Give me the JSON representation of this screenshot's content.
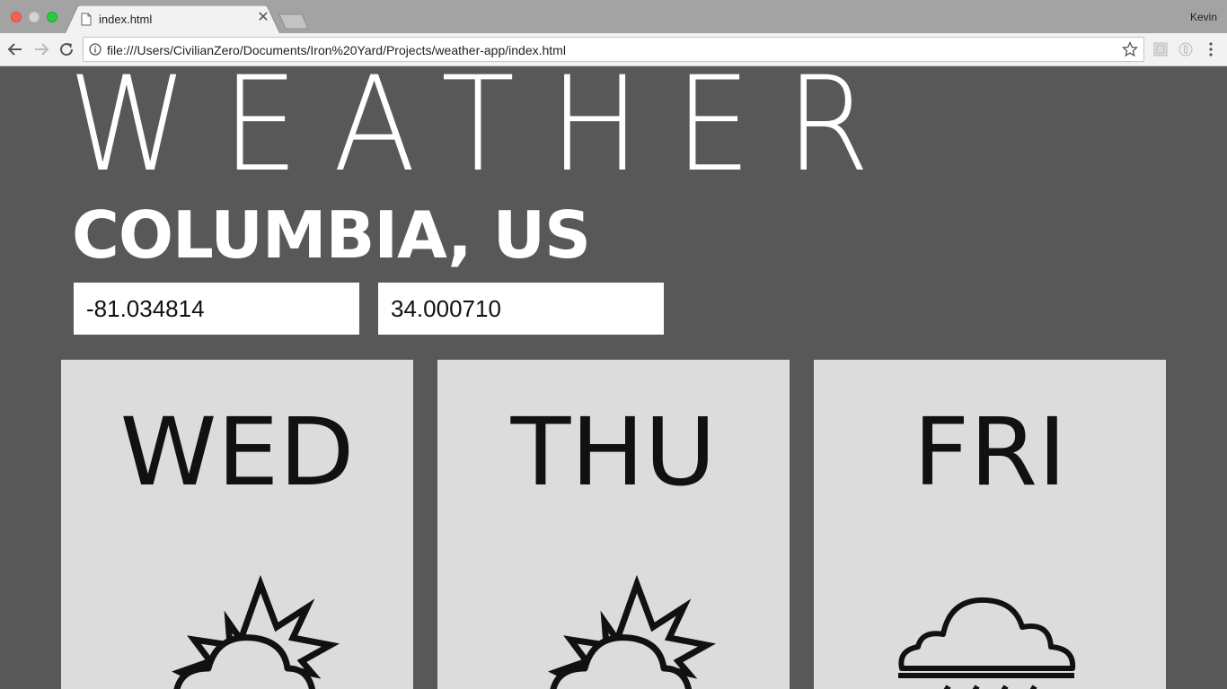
{
  "browser": {
    "tab_title": "index.html",
    "profile_name": "Kevin",
    "url": "file:///Users/CivilianZero/Documents/Iron%20Yard/Projects/weather-app/index.html"
  },
  "app": {
    "title": "WEATHER",
    "location": "COLUMBIA, US",
    "longitude": "-81.034814",
    "latitude": "34.000710"
  },
  "forecast": [
    {
      "day": "WED",
      "icon": "partly-cloudy-icon"
    },
    {
      "day": "THU",
      "icon": "partly-cloudy-icon"
    },
    {
      "day": "FRI",
      "icon": "rain-icon"
    }
  ],
  "colors": {
    "page_background": "#585858",
    "card_background": "#dcdcdc",
    "title_text": "#ffffff"
  }
}
